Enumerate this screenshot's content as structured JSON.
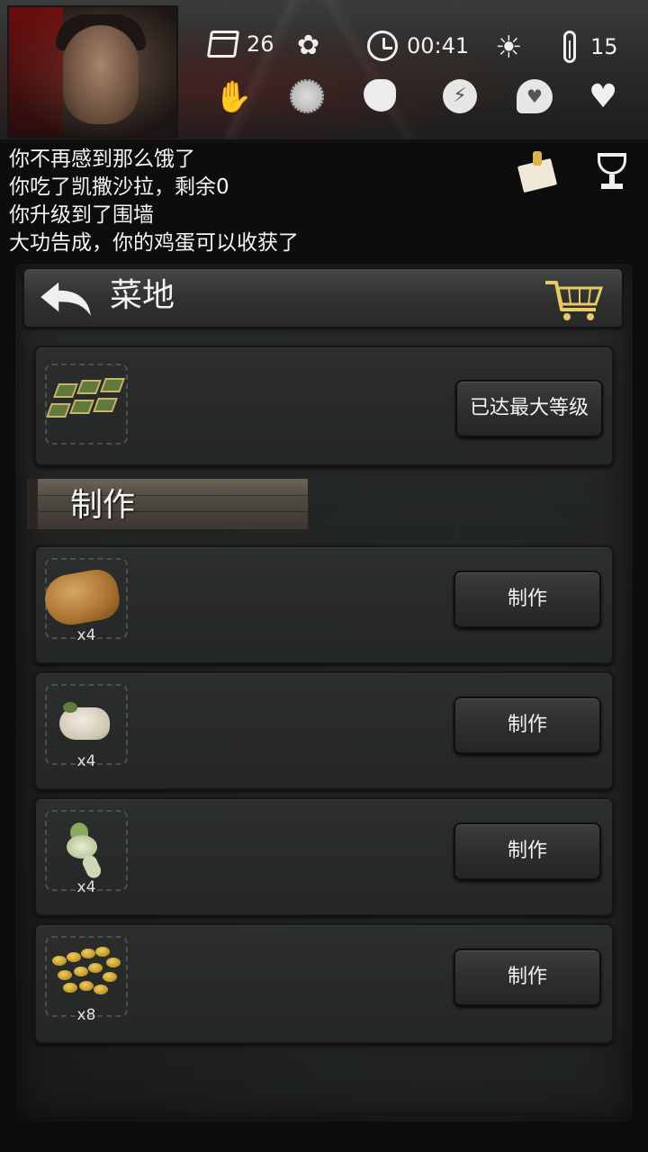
{
  "status": {
    "day": "26",
    "time": "00:41",
    "temperature": "15"
  },
  "log": [
    "你不再感到那么饿了",
    "你吃了凯撒沙拉，剩余0",
    "你升级到了围墙",
    "大功告成，你的鸡蛋可以收获了"
  ],
  "panel": {
    "title": "菜地",
    "upgrade_button": "已达最大等级",
    "section_title": "制作",
    "items": [
      {
        "icon": "potato-icon",
        "qty": "x4",
        "button": "制作"
      },
      {
        "icon": "garlic-icon",
        "qty": "x4",
        "button": "制作"
      },
      {
        "icon": "onion-icon",
        "qty": "x4",
        "button": "制作"
      },
      {
        "icon": "beans-icon",
        "qty": "x8",
        "button": "制作"
      }
    ]
  },
  "icons": {
    "header": [
      "calendar-icon",
      "maple-leaf-icon",
      "clock-icon",
      "sun-icon",
      "thermometer-icon"
    ],
    "needs": [
      "injury-hand-icon",
      "disease-icon",
      "stomach-icon",
      "energy-icon",
      "mood-icon",
      "health-heart-icon"
    ],
    "actions": [
      "notes-icon",
      "trophy-icon",
      "back-arrow-icon",
      "shop-cart-icon"
    ]
  },
  "colors": {
    "background": "#0c0d0c",
    "panel": "#242725",
    "text": "#f2f2f2",
    "blood": "#8c0a0a"
  }
}
